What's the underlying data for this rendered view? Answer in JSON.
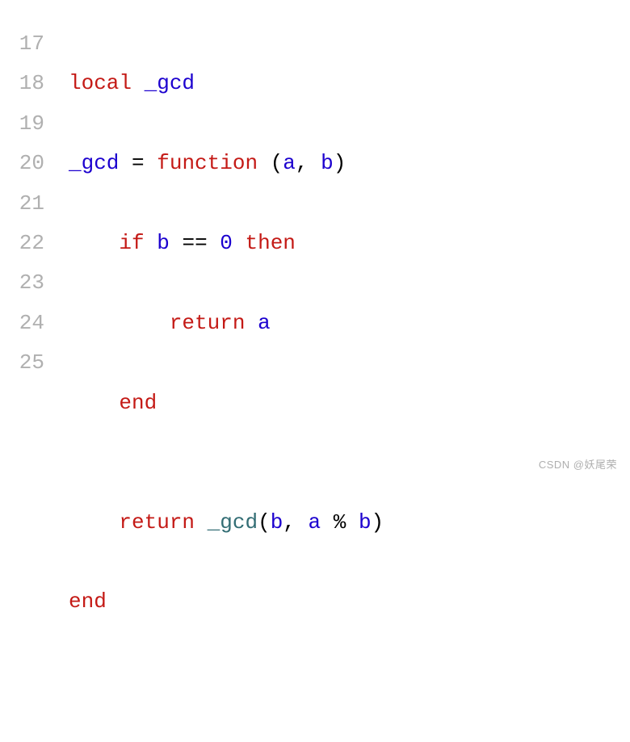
{
  "gutter": {
    "start": 17,
    "lines": [
      "17",
      "18",
      "19",
      "20",
      "21",
      "22",
      "23",
      "24",
      "25"
    ]
  },
  "code": {
    "line17": {
      "kw_local": "local",
      "var_gcd": "_gcd"
    },
    "line18": {
      "var_gcd": "_gcd",
      "eq": " = ",
      "kw_function": "function",
      "params_open": " (",
      "param_a": "a",
      "comma": ", ",
      "param_b": "b",
      "params_close": ")"
    },
    "line19": {
      "kw_if": "if",
      "var_b": "b",
      "op_eqeq": " == ",
      "num_zero": "0",
      "kw_then": "then"
    },
    "line20": {
      "kw_return": "return",
      "var_a": "a"
    },
    "line21": {
      "kw_end": "end"
    },
    "line22": {
      "blank": ""
    },
    "line23": {
      "kw_return": "return",
      "fn_gcd": "_gcd",
      "open": "(",
      "arg_b": "b",
      "comma": ", ",
      "arg_a": "a",
      "op_mod": " % ",
      "arg_b2": "b",
      "close": ")"
    },
    "line24": {
      "kw_end": "end"
    },
    "line25": {
      "blank": ""
    }
  },
  "watermark": "CSDN @妖尾荣"
}
